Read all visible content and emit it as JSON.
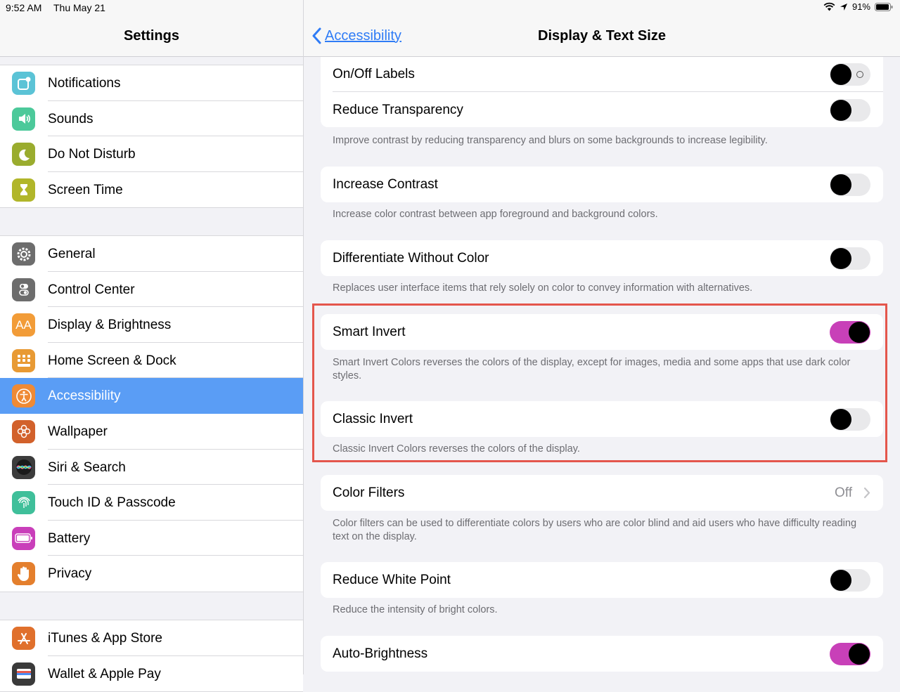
{
  "status": {
    "time": "9:52 AM",
    "date": "Thu May 21",
    "battery": "91%"
  },
  "sidebar": {
    "title": "Settings",
    "groups": [
      {
        "items": [
          {
            "label": "Notifications",
            "icon": "notifications-icon",
            "color": "#5bc3d6"
          },
          {
            "label": "Sounds",
            "icon": "speaker-icon",
            "color": "#4cc99a"
          },
          {
            "label": "Do Not Disturb",
            "icon": "moon-icon",
            "color": "#9aac2e"
          },
          {
            "label": "Screen Time",
            "icon": "hourglass-icon",
            "color": "#b1b62a"
          }
        ]
      },
      {
        "items": [
          {
            "label": "General",
            "icon": "gear-icon",
            "color": "#6d6d6d"
          },
          {
            "label": "Control Center",
            "icon": "toggles-icon",
            "color": "#6d6d6d"
          },
          {
            "label": "Display & Brightness",
            "icon": "text-size-icon",
            "color": "#f29c38"
          },
          {
            "label": "Home Screen & Dock",
            "icon": "app-grid-icon",
            "color": "#e89a34"
          },
          {
            "label": "Accessibility",
            "icon": "accessibility-icon",
            "color": "#ef8a35",
            "selected": true
          },
          {
            "label": "Wallpaper",
            "icon": "flower-icon",
            "color": "#d2612b"
          },
          {
            "label": "Siri & Search",
            "icon": "siri-icon",
            "color": "#3c3c3c"
          },
          {
            "label": "Touch ID & Passcode",
            "icon": "fingerprint-icon",
            "color": "#3fbf9a"
          },
          {
            "label": "Battery",
            "icon": "battery-icon",
            "color": "#c93fba"
          },
          {
            "label": "Privacy",
            "icon": "hand-icon",
            "color": "#e47f2d"
          }
        ]
      },
      {
        "items": [
          {
            "label": "iTunes & App Store",
            "icon": "app-store-icon",
            "color": "#e0702c"
          },
          {
            "label": "Wallet & Apple Pay",
            "icon": "wallet-icon",
            "color": "#3a3a3a"
          }
        ]
      }
    ]
  },
  "main": {
    "back_label": "Accessibility",
    "title": "Display & Text Size",
    "rows": {
      "onoff_labels": {
        "label": "On/Off Labels",
        "on": false
      },
      "reduce_transparency": {
        "label": "Reduce Transparency",
        "on": false
      },
      "increase_contrast": {
        "label": "Increase Contrast",
        "on": false
      },
      "differentiate": {
        "label": "Differentiate Without Color",
        "on": false
      },
      "smart_invert": {
        "label": "Smart Invert",
        "on": true
      },
      "classic_invert": {
        "label": "Classic Invert",
        "on": false
      },
      "color_filters": {
        "label": "Color Filters",
        "value": "Off"
      },
      "reduce_white_point": {
        "label": "Reduce White Point",
        "on": false
      },
      "auto_brightness": {
        "label": "Auto-Brightness",
        "on": true
      }
    },
    "footers": {
      "transparency": "Improve contrast by reducing transparency and blurs on some backgrounds to increase legibility.",
      "contrast": "Increase color contrast between app foreground and background colors.",
      "differentiate": "Replaces user interface items that rely solely on color to convey information with alternatives.",
      "smart_invert": "Smart Invert Colors reverses the colors of the display, except for images, media and some apps that use dark color styles.",
      "classic_invert": "Classic Invert Colors reverses the colors of the display.",
      "color_filters": "Color filters can be used to differentiate colors by users who are color blind and aid users who have difficulty reading text on the display.",
      "white_point": "Reduce the intensity of bright colors."
    }
  },
  "colors": {
    "accent": "#2f7cf6",
    "selected_row": "#5a9df5",
    "toggle_on": "#c840b8",
    "highlight_box": "#e4564c"
  }
}
